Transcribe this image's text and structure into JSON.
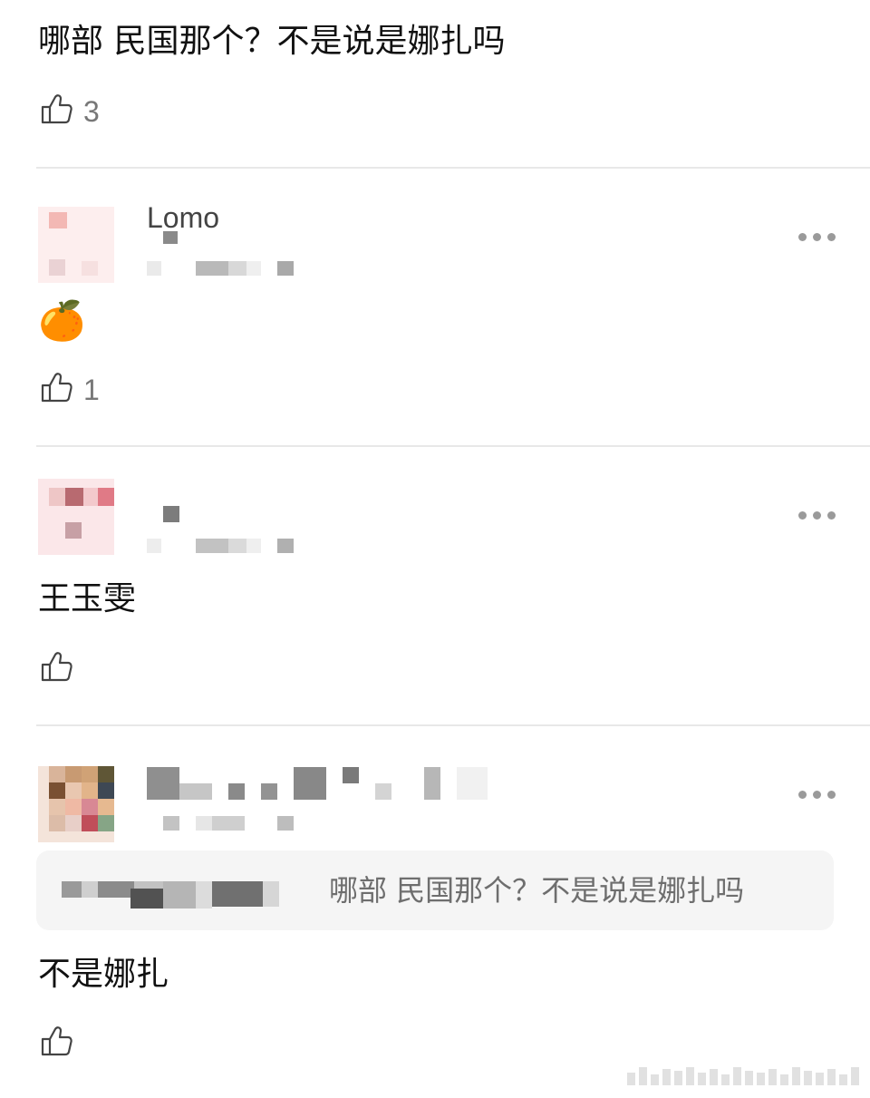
{
  "comments": [
    {
      "text": "哪部 民国那个？不是说是娜扎吗",
      "likes": "3"
    },
    {
      "username_fragment": "Lomo",
      "text": "🍊",
      "likes": "1"
    },
    {
      "text": "王玉雯",
      "likes": ""
    },
    {
      "quote": {
        "text": "哪部 民国那个？不是说是娜扎吗"
      },
      "text": "不是娜扎",
      "likes": ""
    }
  ],
  "icons": {
    "like": "thumbs-up-icon",
    "more": "more-icon"
  },
  "colors": {
    "divider": "#e8e8e8",
    "quote_bg": "#f5f5f5",
    "icon_gray": "#444444",
    "muted_text": "#777777"
  }
}
